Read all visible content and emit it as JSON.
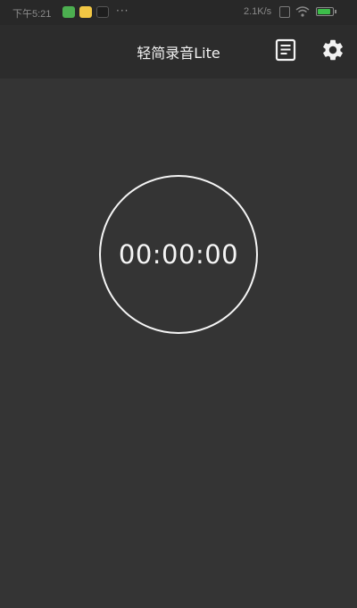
{
  "status_bar": {
    "time": "下午5:21",
    "more_indicator": "···",
    "net_speed": "2.1K/s",
    "sim_icon": "sim-card-icon",
    "wifi_icon": "wifi-icon",
    "battery_icon": "battery-icon",
    "battery_level": 0.9,
    "notification_icons": [
      {
        "name": "wechat-notification-icon",
        "color": "#4caf50"
      },
      {
        "name": "app-notification-icon",
        "color": "#f2c744"
      },
      {
        "name": "dark-app-notification-icon",
        "color": "#222222"
      }
    ]
  },
  "header": {
    "title": "轻简录音Lite",
    "list_icon": "recordings-list-icon",
    "settings_icon": "settings-gear-icon"
  },
  "main": {
    "timer": "00:00:00"
  },
  "colors": {
    "background": "#343434",
    "header_background": "#2c2c2c",
    "status_background": "#282828",
    "foreground": "#f5f5f5"
  }
}
